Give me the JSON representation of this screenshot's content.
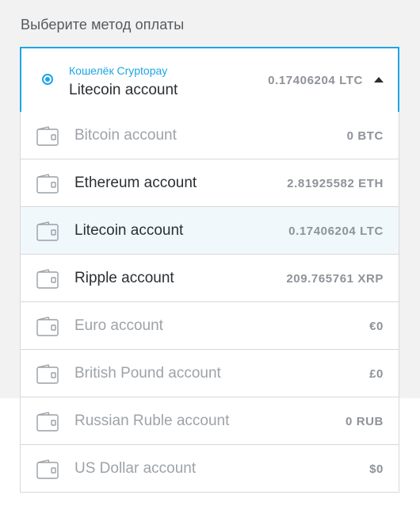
{
  "header": {
    "title": "Выберите метод оплаты"
  },
  "selected": {
    "wallet_label": "Кошелёк Cryptopay",
    "account": "Litecoin account",
    "amount": "0.17406204 LTC",
    "expanded_icon": "caret-up-icon"
  },
  "colors": {
    "accent": "#1ea5e6",
    "active_row_bg": "#f1f8fc",
    "border": "#d6d8da",
    "text_primary": "#2b2f33",
    "text_disabled": "#9ea3a8",
    "amount": "#8e9399",
    "page_bg": "#f2f2f2"
  },
  "accounts": [
    {
      "label": "Bitcoin account",
      "amount": "0 BTC",
      "icon": "wallet-icon",
      "disabled": true,
      "active": false
    },
    {
      "label": "Ethereum account",
      "amount": "2.81925582 ETH",
      "icon": "wallet-icon",
      "disabled": false,
      "active": false
    },
    {
      "label": "Litecoin account",
      "amount": "0.17406204 LTC",
      "icon": "wallet-icon",
      "disabled": false,
      "active": true
    },
    {
      "label": "Ripple account",
      "amount": "209.765761 XRP",
      "icon": "wallet-icon",
      "disabled": false,
      "active": false
    },
    {
      "label": "Euro account",
      "amount": "€0",
      "icon": "wallet-icon",
      "disabled": true,
      "active": false
    },
    {
      "label": "British Pound account",
      "amount": "£0",
      "icon": "wallet-icon",
      "disabled": true,
      "active": false
    },
    {
      "label": "Russian Ruble account",
      "amount": "0 RUB",
      "icon": "wallet-icon",
      "disabled": true,
      "active": false
    },
    {
      "label": "US Dollar account",
      "amount": "$0",
      "icon": "wallet-icon",
      "disabled": true,
      "active": false
    }
  ]
}
